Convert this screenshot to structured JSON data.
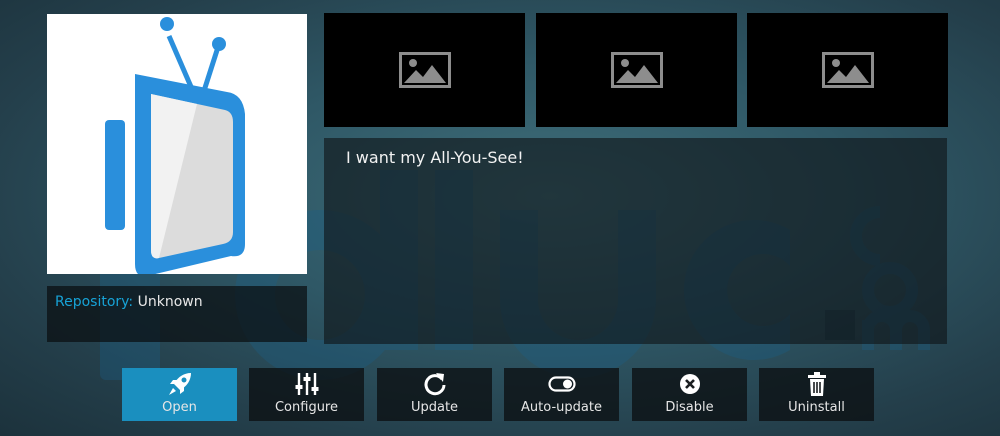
{
  "addon": {
    "repository_label": "Repository:",
    "repository_value": "Unknown",
    "description": "I want my All-You-See!",
    "watermark_text": "alluc.com",
    "screenshots": [
      {
        "icon": "image-placeholder-icon"
      },
      {
        "icon": "image-placeholder-icon"
      },
      {
        "icon": "image-placeholder-icon"
      }
    ]
  },
  "buttons": [
    {
      "label": "Open",
      "icon": "rocket-icon",
      "active": true
    },
    {
      "label": "Configure",
      "icon": "sliders-icon"
    },
    {
      "label": "Update",
      "icon": "refresh-icon"
    },
    {
      "label": "Auto-update",
      "icon": "toggle-icon"
    },
    {
      "label": "Disable",
      "icon": "close-circle-icon"
    },
    {
      "label": "Uninstall",
      "icon": "trash-icon"
    }
  ],
  "colors": {
    "accent": "#1a8fbf",
    "repository_label": "#17a2d6",
    "logo_blue": "#2a8fdc"
  }
}
